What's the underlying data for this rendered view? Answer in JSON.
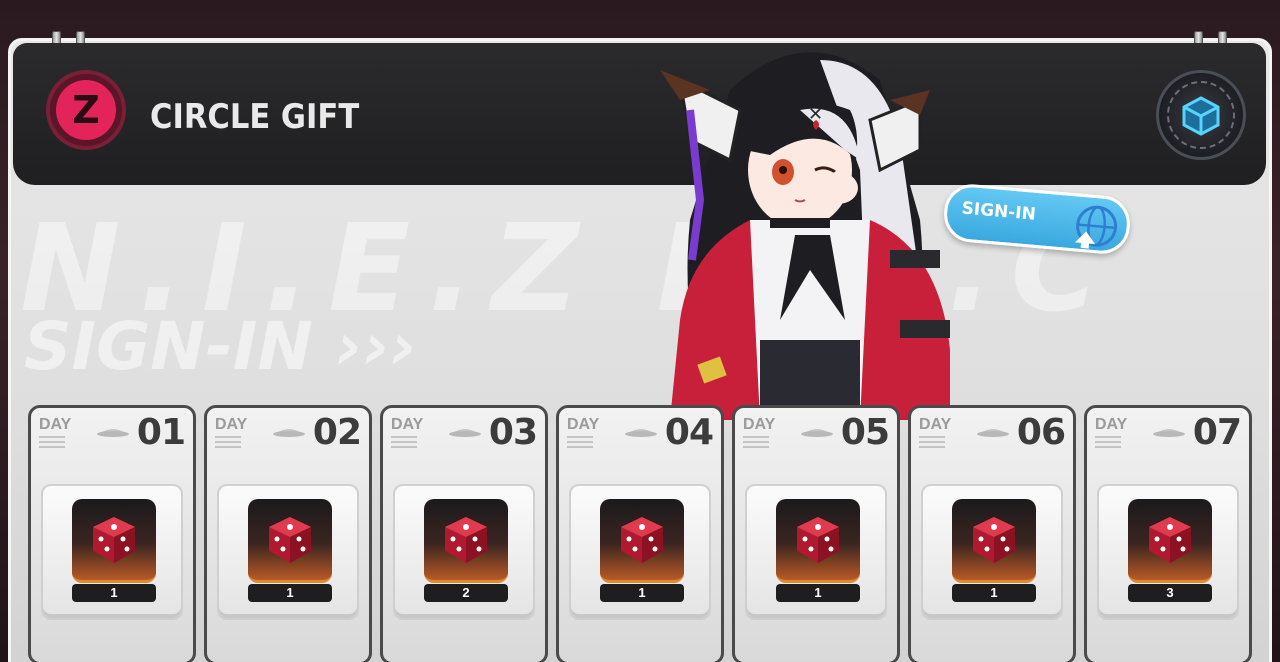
{
  "header": {
    "title": "CIRCLE GIFT",
    "logo_glyph": "Z"
  },
  "watermark": {
    "line1": "N.I.E.Z D.B.C",
    "line2": "SIGN-IN ›››"
  },
  "signin_bubble": {
    "label": "SIGN-IN"
  },
  "days": [
    {
      "label": "DAY",
      "number": "01",
      "reward_icon": "red-dice-icon",
      "quantity": "1"
    },
    {
      "label": "DAY",
      "number": "02",
      "reward_icon": "red-dice-icon",
      "quantity": "1"
    },
    {
      "label": "DAY",
      "number": "03",
      "reward_icon": "red-dice-icon",
      "quantity": "2"
    },
    {
      "label": "DAY",
      "number": "04",
      "reward_icon": "red-dice-icon",
      "quantity": "1"
    },
    {
      "label": "DAY",
      "number": "05",
      "reward_icon": "red-dice-icon",
      "quantity": "1"
    },
    {
      "label": "DAY",
      "number": "06",
      "reward_icon": "red-dice-icon",
      "quantity": "1"
    },
    {
      "label": "DAY",
      "number": "07",
      "reward_icon": "red-dice-icon",
      "quantity": "3"
    }
  ],
  "colors": {
    "accent_pink": "#e2245a",
    "header_bg": "#1f1f21",
    "signin_blue": "#3aa8df",
    "reward_glow": "#e08a30"
  }
}
